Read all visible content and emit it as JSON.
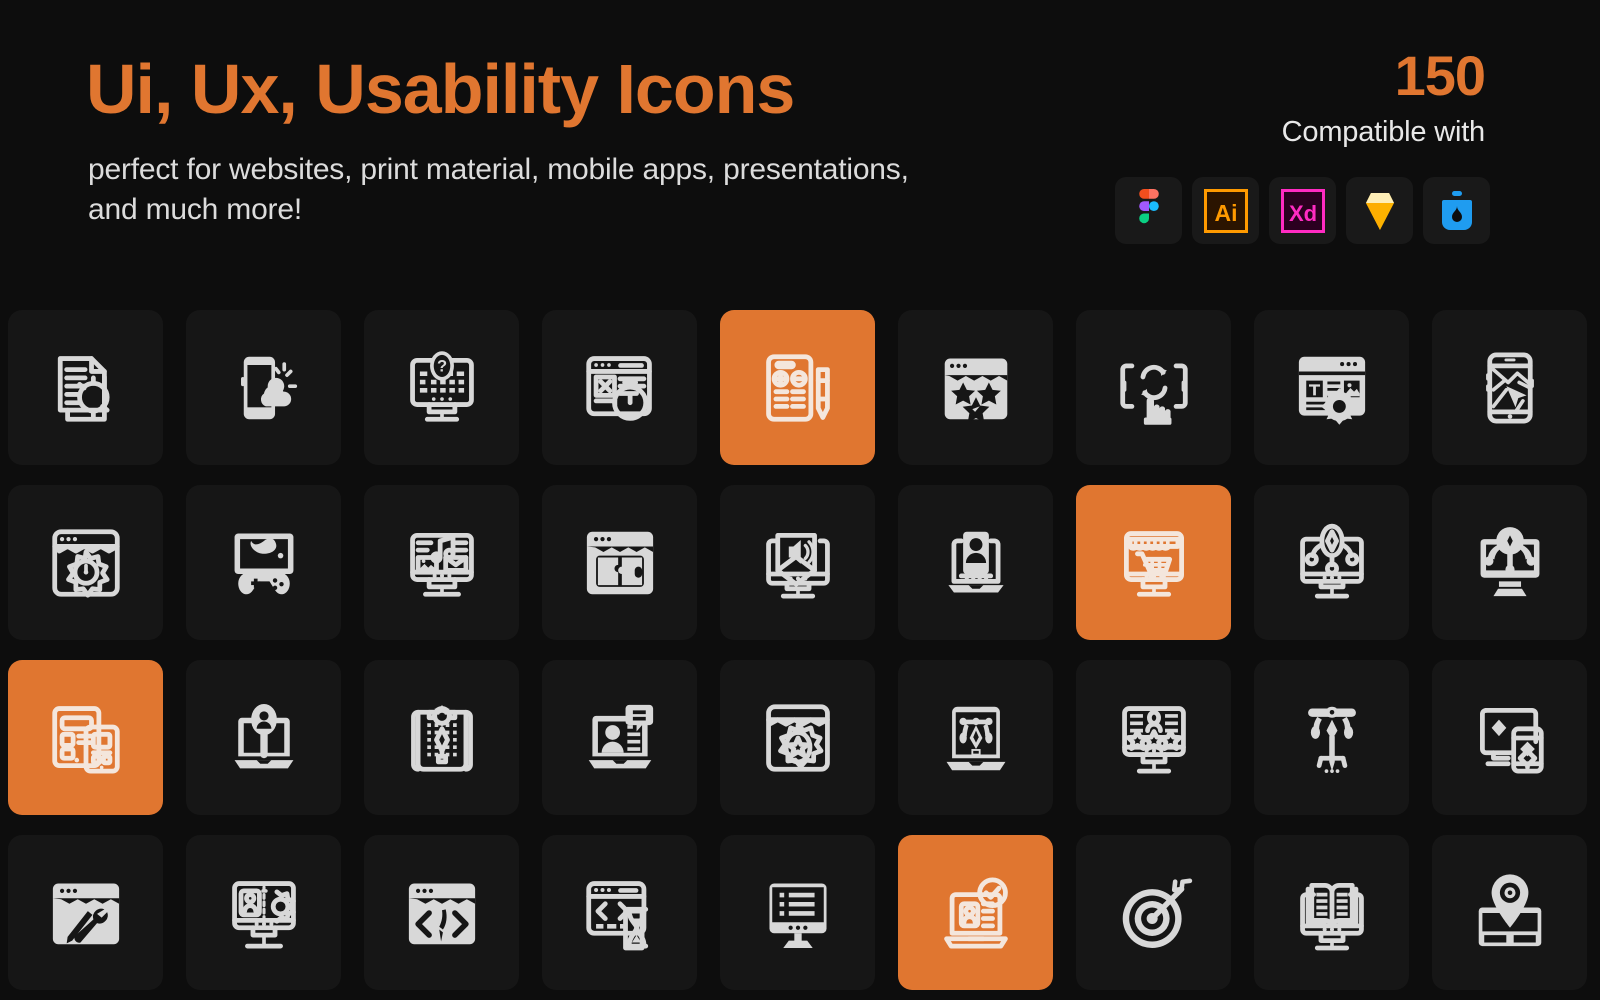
{
  "header": {
    "title": "Ui, Ux, Usability Icons",
    "subtitle": "perfect for websites, print material, mobile apps, presentations, and much more!",
    "count": "150",
    "compatible_label": "Compatible with",
    "accent_color": "#e07630",
    "background_color": "#0d0d0d",
    "tile_color": "#161616",
    "icon_color": "#d8d8d8",
    "badges": [
      {
        "name": "figma",
        "label": "Figma"
      },
      {
        "name": "illustrator",
        "label": "Ai"
      },
      {
        "name": "adobe-xd",
        "label": "Xd"
      },
      {
        "name": "sketch",
        "label": "Sketch"
      },
      {
        "name": "invision-studio",
        "label": "InVision"
      }
    ]
  },
  "grid": {
    "columns": 9,
    "rows": 4,
    "tiles": [
      {
        "name": "document-sync-icon",
        "label": "Document Sync",
        "active": false
      },
      {
        "name": "mobile-weather-icon",
        "label": "Mobile Weather",
        "active": false
      },
      {
        "name": "desktop-help-icon",
        "label": "Desktop Help / FAQ",
        "active": false
      },
      {
        "name": "browser-error-timer-icon",
        "label": "Browser Error Timer",
        "active": false
      },
      {
        "name": "wireframe-edit-icon",
        "label": "Wireframe Edit",
        "active": true
      },
      {
        "name": "browser-favourites-stars-icon",
        "label": "Browser Favourites",
        "active": false
      },
      {
        "name": "screen-rotate-touch-icon",
        "label": "Screen Rotate Touch",
        "active": false
      },
      {
        "name": "browser-typography-settings-icon",
        "label": "Typography Settings",
        "active": false
      },
      {
        "name": "mobile-map-navigation-icon",
        "label": "Mobile Map Navigation",
        "active": false
      },
      {
        "name": "browser-settings-speed-icon",
        "label": "Browser Settings Speed",
        "active": false
      },
      {
        "name": "game-controller-screen-icon",
        "label": "Game Controller Screen",
        "active": false
      },
      {
        "name": "desktop-media-content-icon",
        "label": "Desktop Media Content",
        "active": false
      },
      {
        "name": "browser-puzzle-icon",
        "label": "Browser Puzzle",
        "active": false
      },
      {
        "name": "desktop-email-audio-icon",
        "label": "Desktop Email Audio",
        "active": false
      },
      {
        "name": "laptop-user-profile-icon",
        "label": "Laptop User Profile",
        "active": false
      },
      {
        "name": "desktop-ecommerce-shop-icon",
        "label": "Desktop Ecommerce Shop",
        "active": true
      },
      {
        "name": "desktop-pen-tool-nodes-icon",
        "label": "Desktop Pen Tool Nodes",
        "active": false
      },
      {
        "name": "desktop-pen-tool-solid-icon",
        "label": "Desktop Pen Tool Solid",
        "active": false
      },
      {
        "name": "responsive-wireframe-icon",
        "label": "Responsive Wireframe",
        "active": true
      },
      {
        "name": "laptop-user-search-icon",
        "label": "Laptop User Search",
        "active": false
      },
      {
        "name": "blueprint-settings-icon",
        "label": "Blueprint Settings",
        "active": false
      },
      {
        "name": "laptop-user-feedback-icon",
        "label": "Laptop User Feedback",
        "active": false
      },
      {
        "name": "browser-gear-star-icon",
        "label": "Browser Gear Star",
        "active": false
      },
      {
        "name": "laptop-pen-tool-icon",
        "label": "Laptop Pen Tool",
        "active": false
      },
      {
        "name": "desktop-user-rating-icon",
        "label": "Desktop User Rating",
        "active": false
      },
      {
        "name": "compass-drafting-icon",
        "label": "Compass Drafting",
        "active": false
      },
      {
        "name": "responsive-design-layers-icon",
        "label": "Responsive Design Layers",
        "active": false
      },
      {
        "name": "browser-design-tools-icon",
        "label": "Browser Design Tools",
        "active": false
      },
      {
        "name": "desktop-user-settings-icon",
        "label": "Desktop User Settings",
        "active": false
      },
      {
        "name": "browser-code-design-icon",
        "label": "Browser Code Design",
        "active": false
      },
      {
        "name": "browser-code-hourglass-icon",
        "label": "Browser Code Hourglass",
        "active": false
      },
      {
        "name": "desktop-list-view-icon",
        "label": "Desktop List View",
        "active": false
      },
      {
        "name": "laptop-profile-approved-icon",
        "label": "Laptop Profile Approved",
        "active": true
      },
      {
        "name": "target-arrow-icon",
        "label": "Target Arrow",
        "active": false
      },
      {
        "name": "desktop-book-learning-icon",
        "label": "Desktop Book Learning",
        "active": false
      },
      {
        "name": "map-location-pin-icon",
        "label": "Map Location Pin",
        "active": false
      }
    ]
  }
}
